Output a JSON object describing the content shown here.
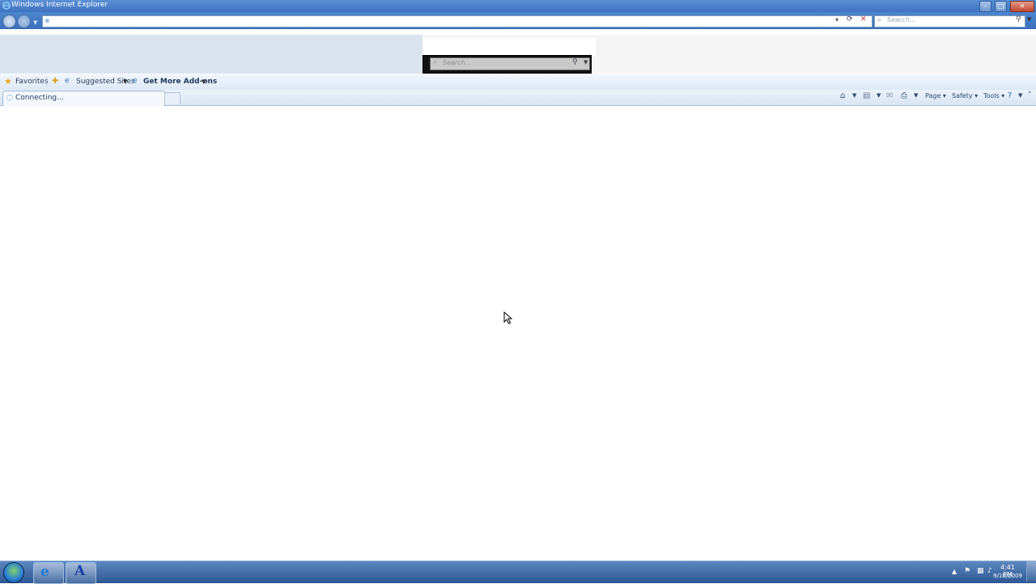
{
  "window": {
    "title": "Windows Internet Explorer"
  },
  "address_bar": {
    "value": "",
    "search_placeholder": "Search..."
  },
  "floating_search": {
    "placeholder": "Search..."
  },
  "favorites_bar": {
    "favorites_label": "Favorites",
    "suggested_sites_label": "Suggested Sites",
    "get_addons_label": "Get More Add-ons"
  },
  "tab": {
    "label": "Connecting..."
  },
  "command_bar": {
    "page_label": "Page",
    "safety_label": "Safety",
    "tools_label": "Tools"
  },
  "taskbar": {
    "clock_time": "4:41 PM",
    "clock_date": "9/10/2009"
  },
  "colors": {
    "titlebar": "#3e74c0",
    "taskbar": "#2e5893",
    "accent": "#1f73c9"
  }
}
